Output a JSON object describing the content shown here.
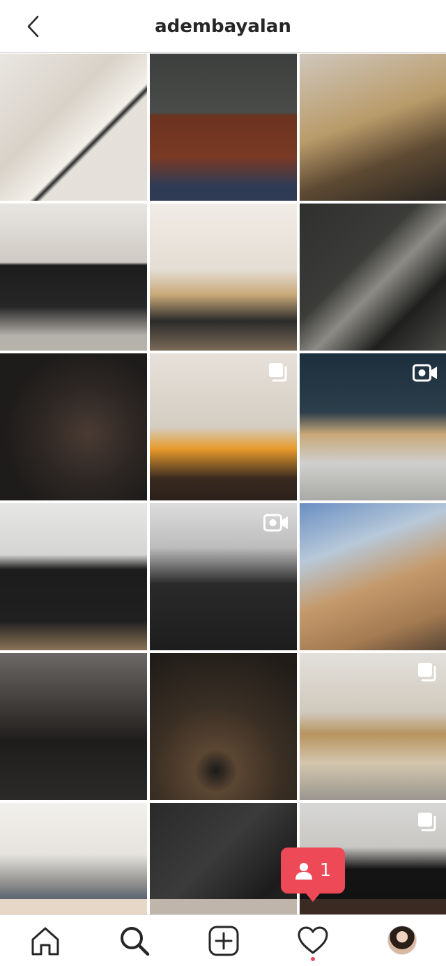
{
  "header": {
    "title": "adembayalan",
    "back_icon": "chevron-left-icon"
  },
  "grid": {
    "tiles": [
      {
        "name": "photo-tile",
        "overlay": "",
        "bg": "linear-gradient(135deg,#e9e6e1 0%,#d8d2c8 40%,#f3f0ea 60%,#2a2a2a 62%,#e5e1da 64%)"
      },
      {
        "name": "photo-tile",
        "overlay": "",
        "bg": "linear-gradient(180deg,#3c3f3d 0%,#4a4c49 40%,#6b3320 42%,#7a3a24 70%,#2f3b55 90%)"
      },
      {
        "name": "photo-tile",
        "overlay": "",
        "bg": "linear-gradient(160deg,#cfc7bc 0%,#b99b6a 45%,#5e4a33 70%,#2a2622 100%)"
      },
      {
        "name": "photo-tile",
        "overlay": "",
        "bg": "linear-gradient(180deg,#e8e6e2 0%,#cfcac3 40%,#1d1d1d 42%,#262626 70%,#b5b1ab 90%)"
      },
      {
        "name": "photo-tile",
        "overlay": "",
        "bg": "linear-gradient(180deg,#f1ece6 0%,#e4ddd3 45%,#c9a978 62%,#2b2b2b 80%,#7a6a58 100%)"
      },
      {
        "name": "photo-tile",
        "overlay": "",
        "bg": "linear-gradient(135deg,#2f302e 0%,#3b3c39 40%,#8d8b86 55%,#1f201e 75%,#4a4a47 100%)"
      },
      {
        "name": "photo-tile",
        "overlay": "",
        "bg": "radial-gradient(circle at 60% 55%,#4a3b33 0%,#2d2724 40%,#1e1c1b 70%)"
      },
      {
        "name": "photo-tile",
        "overlay": "carousel",
        "bg": "linear-gradient(180deg,#e6e1da 0%,#d4cdc2 50%,#e79a2b 65%,#3a2a20 85%,#2a201a 100%)"
      },
      {
        "name": "photo-tile",
        "overlay": "video",
        "bg": "linear-gradient(180deg,#1c2f3d 0%,#2c3e4a 40%,#c8a878 55%,#cfcfcd 75%,#a9a9a6 100%)"
      },
      {
        "name": "photo-tile",
        "overlay": "",
        "bg": "linear-gradient(180deg,#e6e6e4 0%,#d5d5d3 35%,#1c1c1c 45%,#202020 80%,#8b7357 100%)"
      },
      {
        "name": "photo-tile",
        "overlay": "video",
        "bg": "linear-gradient(180deg,#dcdcdc 0%,#bdbdbd 30%,#2a2a2a 55%,#1d1d1d 100%)"
      },
      {
        "name": "photo-tile",
        "overlay": "",
        "bg": "linear-gradient(160deg,#6a8fc2 0%,#b7c8d9 30%,#c49a6c 55%,#a47b52 80%,#5a4636 100%)"
      },
      {
        "name": "photo-tile",
        "overlay": "",
        "bg": "linear-gradient(180deg,#6b6866 0%,#3a3634 40%,#1f1d1c 60%,#2c2a29 100%)"
      },
      {
        "name": "photo-tile",
        "overlay": "",
        "bg": "radial-gradient(circle at 45% 80%,#1a1a1a 0%,#5b4632 15%,#3a2f25 45%,#201c18 90%)"
      },
      {
        "name": "photo-tile",
        "overlay": "carousel",
        "bg": "linear-gradient(180deg,#e3e0db 0%,#d0c9bd 40%,#b7935f 55%,#d4c6ae 75%,#9a968f 100%)"
      },
      {
        "name": "photo-tile",
        "overlay": "",
        "bg": "linear-gradient(180deg,#f2f0ec 0%,#e6e3de 35%,#8e8e8c 55%,#2d3a55 75%,#c59a5f 100%)"
      },
      {
        "name": "photo-tile",
        "overlay": "",
        "bg": "linear-gradient(135deg,#2a2a2a 0%,#3b3b3b 40%,#1c1c1c 70%,#2f2f2f 100%)"
      },
      {
        "name": "photo-tile",
        "overlay": "carousel",
        "bg": "linear-gradient(180deg,#d7d7d6 0%,#c9c7c3 30%,#141414 45%,#0f0f0f 100%)"
      }
    ],
    "partial_row": [
      "#e6d7c6",
      "#bfb5aa",
      "#3a2a22"
    ]
  },
  "notification": {
    "count": "1",
    "icon": "person-icon"
  },
  "tabbar": {
    "home_icon": "home-icon",
    "search_icon": "search-icon",
    "add_icon": "add-post-icon",
    "activity_icon": "heart-icon",
    "profile_icon": "profile-avatar"
  },
  "colors": {
    "accent": "#ed4956",
    "text": "#262626",
    "border": "#dbdbdb"
  }
}
